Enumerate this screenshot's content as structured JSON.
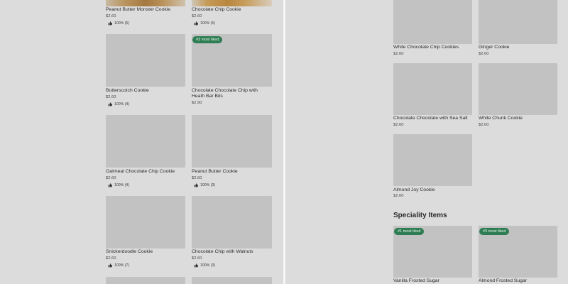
{
  "left_menu": {
    "items": [
      {
        "title": "Peanut Butter Monster Cookie",
        "price": "$2.60",
        "rating": "100% (5)"
      },
      {
        "title": "Chocolate Chip Cookie",
        "price": "$2.60",
        "rating": "100% (6)"
      },
      {
        "title": "Butterscotch Cookie",
        "price": "$2.60",
        "rating": "100% (4)"
      },
      {
        "title": "Chocolate Chocolate Chip with Heath Bar Bits",
        "price": "$2.90",
        "badge": "#3 most liked"
      },
      {
        "title": "Oatmeal Chocolate Chip Cookie",
        "price": "$2.60",
        "rating": "100% (4)"
      },
      {
        "title": "Peanut Butter Cookie",
        "price": "$2.60",
        "rating": "100% (3)"
      },
      {
        "title": "Snickerdoodle Cookie",
        "price": "$2.60",
        "rating": "100% (7)"
      },
      {
        "title": "Chocolate Chip with Walnuts",
        "price": "$2.60",
        "rating": "100% (3)"
      }
    ]
  },
  "right_menu": {
    "items": [
      {
        "title": "White Chocolate Chip Cookies",
        "price": "$2.60"
      },
      {
        "title": "Ginger Cookie",
        "price": "$2.60"
      },
      {
        "title": "Chocolate Chocolate with Sea Salt",
        "price": "$2.60"
      },
      {
        "title": "White Chunk Cookie",
        "price": "$2.60"
      },
      {
        "title": "Almond Joy Cookie",
        "price": "$2.60"
      }
    ],
    "speciality": {
      "heading": "Speciality Items",
      "items": [
        {
          "title": "Vanilla Frosted Sugar",
          "badge": "#1 most liked"
        },
        {
          "title": "Almond Frosted Sugar",
          "badge": "#3 most liked"
        }
      ]
    }
  },
  "icons": {
    "rating": "thumbs-up-icon"
  },
  "colors": {
    "badge": "#2e7d52",
    "thumbnail_placeholder": "#c2c2c2",
    "background": "#dcdcdc"
  }
}
